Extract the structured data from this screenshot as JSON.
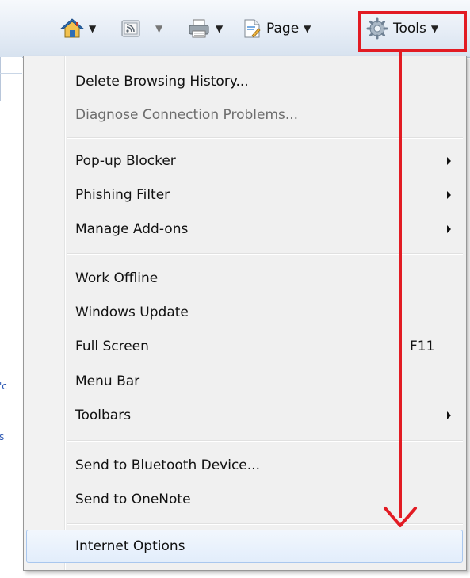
{
  "toolbar": {
    "home_icon": "home-icon",
    "feeds_icon": "feeds-icon",
    "print_icon": "print-icon",
    "page_icon": "page-icon",
    "page_label": "Page",
    "tools_icon": "gear-icon",
    "tools_label": "Tools",
    "caret": "▼"
  },
  "left_sliver": {
    "text_1": "'c",
    "text_2": "s"
  },
  "menu": {
    "items": [
      {
        "label": "Delete Browsing History...",
        "disabled": false
      },
      {
        "label": "Diagnose Connection Problems...",
        "disabled": true
      },
      {
        "label": "Pop-up Blocker",
        "submenu": true
      },
      {
        "label": "Phishing Filter",
        "submenu": true
      },
      {
        "label": "Manage Add-ons",
        "submenu": true
      },
      {
        "label": "Work Offline"
      },
      {
        "label": "Windows Update"
      },
      {
        "label": "Full Screen",
        "shortcut": "F11"
      },
      {
        "label": "Menu Bar"
      },
      {
        "label": "Toolbars",
        "submenu": true
      },
      {
        "label": "Send to Bluetooth Device..."
      },
      {
        "label": "Send to OneNote"
      },
      {
        "label": "Internet Options",
        "highlighted": true
      }
    ]
  },
  "annotation": {
    "highlight_color": "#e21b23"
  }
}
